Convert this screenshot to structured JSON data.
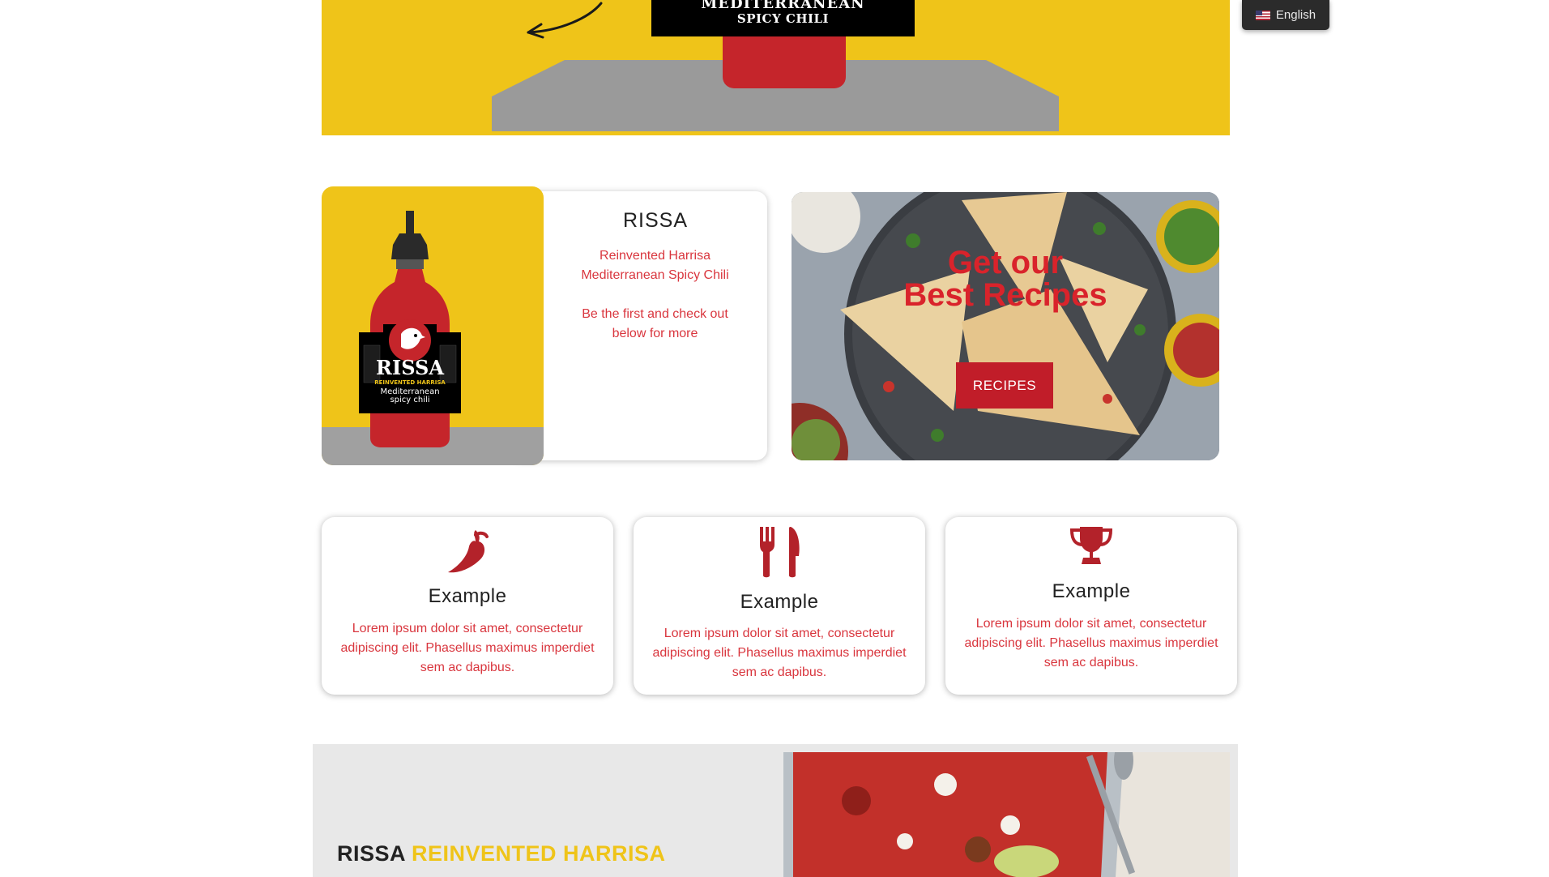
{
  "hero": {
    "label_line": "SPICY CHILI",
    "colors": {
      "yellow": "#efc419",
      "gray": "#9a9a9a",
      "black": "#000000",
      "red": "#c5252b"
    }
  },
  "language_switcher": {
    "flag_icon": "us-flag-icon",
    "label": "English"
  },
  "product_card": {
    "title": "RISSA",
    "subtitle_line1": "Reinvented Harrisa",
    "subtitle_line2": "Mediterranean Spicy Chili",
    "cta_line1": "Be the first and check out",
    "cta_line2": "below for more",
    "bottle_brand": "RISSA",
    "bottle_tagline": "REINVENTED HARRISA",
    "bottle_desc1": "Mediterranean",
    "bottle_desc2": "spicy chili"
  },
  "recipes_card": {
    "title_line1": "Get our",
    "title_line2": "Best Recipes",
    "button_label": "RECIPES"
  },
  "features": [
    {
      "icon": "chili-pepper-icon",
      "title": "Example",
      "text": "Lorem ipsum dolor sit amet, consectetur adipiscing elit. Phasellus maximus imperdiet sem ac dapibus."
    },
    {
      "icon": "fork-knife-icon",
      "title": "Example",
      "text": "Lorem ipsum dolor sit amet, consectetur adipiscing elit. Phasellus maximus imperdiet sem ac dapibus."
    },
    {
      "icon": "trophy-icon",
      "title": "Example",
      "text": "Lorem ipsum dolor sit amet, consectetur adipiscing elit. Phasellus maximus imperdiet sem ac dapibus."
    }
  ],
  "band": {
    "title_dark": "RISSA",
    "title_accent": "REINVENTED HARRISA"
  },
  "colors": {
    "accent_red": "#d9363e",
    "button_red": "#c11d29",
    "brand_yellow": "#efc419"
  }
}
